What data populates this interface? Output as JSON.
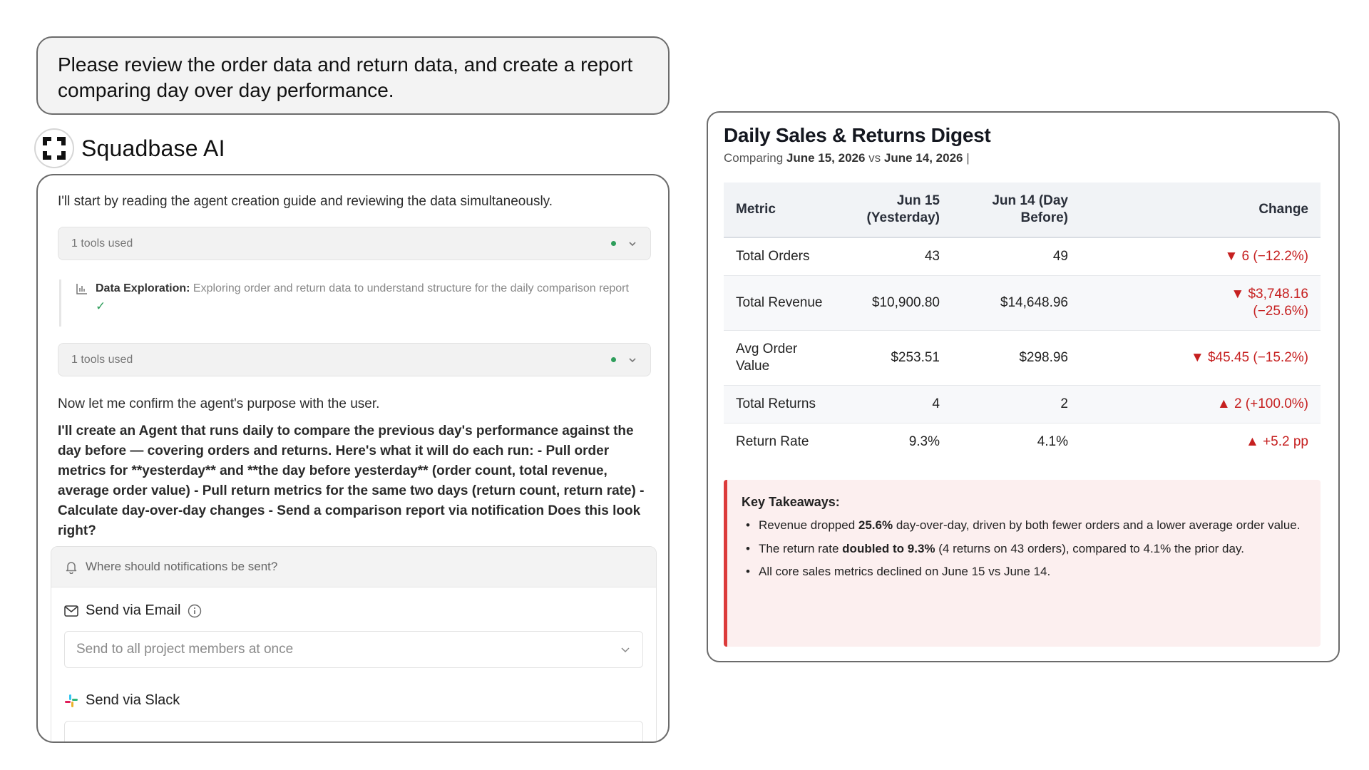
{
  "user_prompt": "Please review the order data and return data, and create a report comparing day over day performance.",
  "assistant": {
    "name": "Squadbase AI"
  },
  "chat": {
    "message_1": "I'll start by reading the agent creation guide and reviewing the data simultaneously.",
    "tools_used_label": "1 tools used",
    "exploration": {
      "label": "Data Exploration:",
      "text": "Exploring order and return data to understand structure for the daily comparison report"
    },
    "message_2": "Now let me confirm the agent's purpose with the user.",
    "message_3": "I'll create an Agent that runs daily to compare the previous day's performance against the day before — covering orders and returns. Here's what it will do each run: - Pull order metrics for **yesterday** and **the day before yesterday** (order count, total revenue, average order value) - Pull return metrics for the same two days (return count, return rate) - Calculate day-over-day changes - Send a comparison report via notification Does this look right?",
    "notify": {
      "header": "Where should notifications be sent?",
      "email_label": "Send via Email",
      "email_select_value": "Send to all project members at once",
      "slack_label": "Send via Slack"
    }
  },
  "report": {
    "title": "Daily Sales & Returns Digest",
    "subtitle_prefix": "Comparing ",
    "date_current": "June 15, 2026",
    "vs": " vs ",
    "date_previous": "June 14, 2026",
    "subtitle_suffix": "  |",
    "columns": [
      "Metric",
      "Jun 15 (Yesterday)",
      "Jun 14 (Day Before)",
      "Change"
    ],
    "rows": [
      {
        "metric": "Total Orders",
        "current": "43",
        "previous": "49",
        "change": "▼ 6 (−12.2%)"
      },
      {
        "metric": "Total Revenue",
        "current": "$10,900.80",
        "previous": "$14,648.96",
        "change": "▼ $3,748.16 (−25.6%)"
      },
      {
        "metric": "Avg Order Value",
        "current": "$253.51",
        "previous": "$298.96",
        "change": "▼ $45.45 (−15.2%)"
      },
      {
        "metric": "Total Returns",
        "current": "4",
        "previous": "2",
        "change": "▲ 2 (+100.0%)"
      },
      {
        "metric": "Return Rate",
        "current": "9.3%",
        "previous": "4.1%",
        "change": "▲ +5.2 pp"
      }
    ],
    "takeaways": {
      "heading": "Key Takeaways:",
      "item1_a": "Revenue dropped ",
      "item1_b": "25.6%",
      "item1_c": " day-over-day, driven by both fewer orders and a lower average order value.",
      "item2_a": "The return rate ",
      "item2_b": "doubled to 9.3%",
      "item2_c": " (4 returns on 43 orders), compared to 4.1% the prior day.",
      "item3": "All core sales metrics declined on June 15 vs June 14."
    }
  },
  "colors": {
    "decline": "#c62020",
    "takeaway_border": "#dc3b3b",
    "takeaway_bg": "#fcefef",
    "status_dot": "#2e9e5b"
  }
}
